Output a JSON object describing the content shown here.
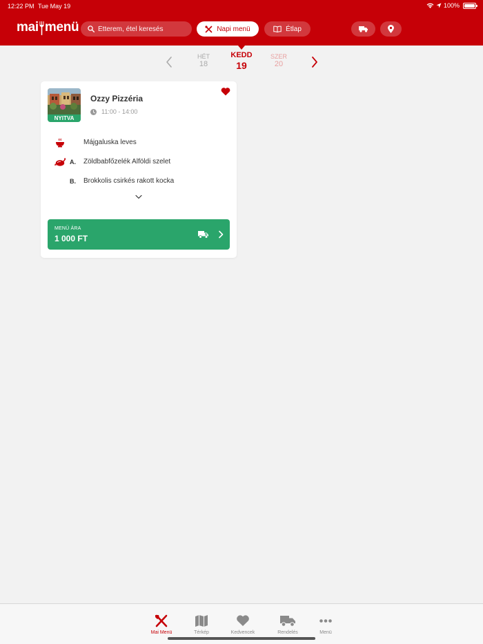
{
  "status": {
    "time": "12:22 PM",
    "date": "Tue May 19",
    "battery": "100%"
  },
  "header": {
    "logo": {
      "part1": "mai",
      "part2": "menü"
    },
    "search": {
      "placeholder": "Étterem, étel keresés",
      "icon": "search-icon"
    },
    "napi_menu_label": "Napi menü",
    "etlap_label": "Étlap",
    "truck_icon": "truck-icon",
    "location_icon": "location-pin-icon"
  },
  "day_selector": {
    "prev": {
      "name": "HÉT",
      "num": "18"
    },
    "current": {
      "name": "KEDD",
      "num": "19"
    },
    "next": {
      "name": "SZER",
      "num": "20"
    }
  },
  "restaurant": {
    "name": "Ozzy Pizzéria",
    "status_badge": "NYITVA",
    "hours": "11:00 - 14:00",
    "favorite": true,
    "dishes": [
      {
        "letter": "",
        "name": "Májgaluska leves",
        "icon": "soup-bowl-icon"
      },
      {
        "letter": "A.",
        "name": "Zöldbabfőzelék Alföldi szelet",
        "icon": "roast-chicken-icon"
      },
      {
        "letter": "B.",
        "name": "Brokkolis csirkés rakott kocka",
        "icon": ""
      }
    ],
    "price_label": "MENÜ ÁRA",
    "price_value": "1 000 FT"
  },
  "tabbar": {
    "items": [
      {
        "label": "Mai Menü",
        "icon": "fork-knife-icon",
        "active": true
      },
      {
        "label": "Térkép",
        "icon": "map-icon",
        "active": false
      },
      {
        "label": "Kedvencek",
        "icon": "heart-icon",
        "active": false
      },
      {
        "label": "Rendelés",
        "icon": "truck-icon",
        "active": false
      },
      {
        "label": "Menü",
        "icon": "more-dots-icon",
        "active": false
      }
    ]
  },
  "colors": {
    "brand": "#c60007",
    "open_green": "#2aa56b",
    "background": "#f2f2f2"
  }
}
